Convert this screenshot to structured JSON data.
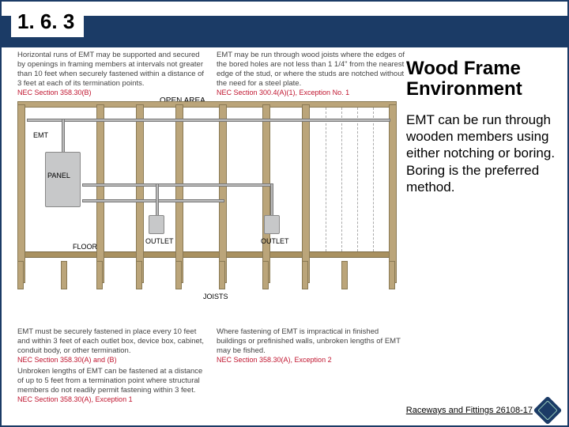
{
  "header": {
    "number": "1. 6. 3"
  },
  "right": {
    "title_line1": "Wood Frame",
    "title_line2": "Environment",
    "body": "EMT can be run through wooden members using either notching or boring. Boring is the preferred method."
  },
  "captions": {
    "c1_text": "Horizontal runs of EMT may be supported and secured by openings in framing members at intervals not greater than 10 feet when securely fastened within a distance of 3 feet at each of its termination points.",
    "c1_ref": "NEC Section 358.30(B)",
    "c2_text": "EMT may be run through wood joists where the edges of the bored holes are not less than 1 1/4\" from the nearest edge of the stud, or where the studs are notched without the need for a steel plate.",
    "c2_ref": "NEC Section 300.4(A)(1), Exception No. 1",
    "c3_text": "EMT must be securely fastened in place every 10 feet and within 3 feet of each outlet box, device box, cabinet, conduit body, or other termination.",
    "c3_ref": "NEC Section 358.30(A) and (B)",
    "c4_text": "Where fastening of EMT is impractical in finished buildings or prefinished walls, unbroken lengths of EMT may be fished.",
    "c4_ref": "NEC Section 358.30(A), Exception 2",
    "c5_text": "Unbroken lengths of EMT can be fastened at a distance of up to 5 feet from a termination point where structural members do not readily permit fastening within 3 feet.",
    "c5_ref": "NEC Section 358.30(A), Exception 1"
  },
  "labels": {
    "open_area": "OPEN AREA",
    "emt": "EMT",
    "panel": "PANEL",
    "floor": "FLOOR",
    "outlet": "OUTLET",
    "joists": "JOISTS"
  },
  "footer": {
    "text": "Raceways and Fittings 26108-17"
  },
  "chart_data": {
    "type": "table",
    "title": "Wood Frame Environment — EMT installation",
    "nec_references": [
      "NEC Section 358.30(B)",
      "NEC Section 300.4(A)(1), Exception No. 1",
      "NEC Section 358.30(A) and (B)",
      "NEC Section 358.30(A), Exception 2",
      "NEC Section 358.30(A), Exception 1"
    ],
    "diagram_labels": [
      "OPEN AREA",
      "EMT",
      "PANEL",
      "FLOOR",
      "OUTLET",
      "OUTLET",
      "JOISTS"
    ]
  }
}
